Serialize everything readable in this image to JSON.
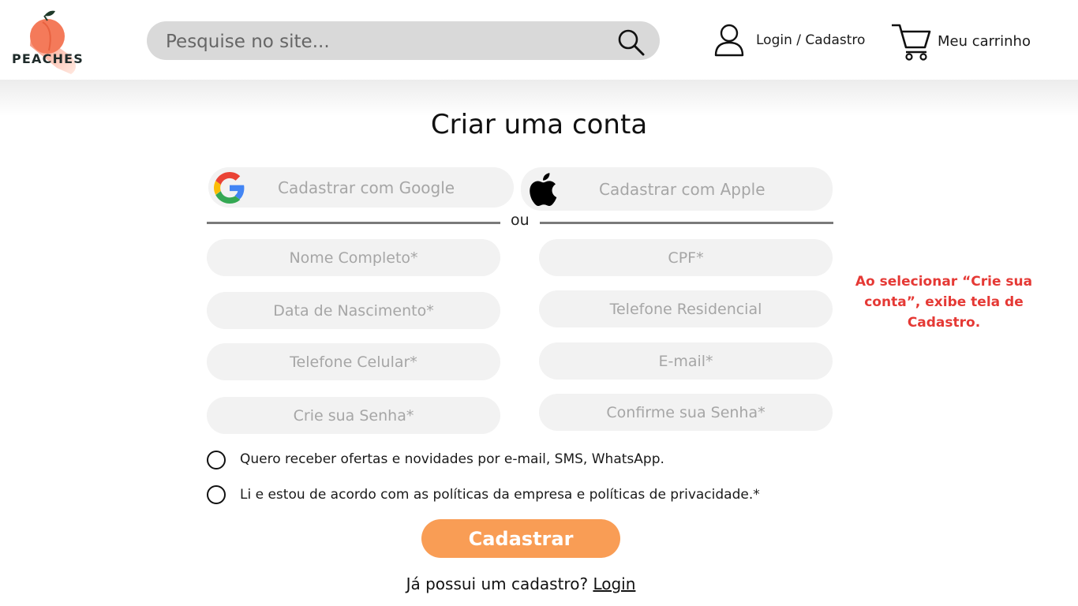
{
  "header": {
    "logo_text": "PEACHES",
    "search_placeholder": "Pesquise no site...",
    "account_label": "Login / Cadastro",
    "cart_label": "Meu carrinho"
  },
  "form": {
    "title": "Criar uma conta",
    "google_label": "Cadastrar com Google",
    "apple_label": "Cadastrar com Apple",
    "separator": "ou",
    "fields": {
      "nome": "Nome Completo*",
      "cpf": "CPF*",
      "nascimento": "Data de Nascimento*",
      "telefone_residencial": "Telefone Residencial",
      "celular": "Telefone Celular*",
      "email": "E-mail*",
      "senha": "Crie sua Senha*",
      "confirmar_senha": "Confirme sua Senha*"
    },
    "checkbox_offers": "Quero receber ofertas e novidades por e-mail, SMS, WhatsApp.",
    "checkbox_terms": "Li e estou de acordo com as  políticas da empresa e políticas de privacidade.*",
    "submit_label": "Cadastrar",
    "login_prompt": "Já possui um cadastro?",
    "login_link": "Login"
  },
  "annotation": {
    "text": "Ao selecionar “Crie sua conta”, exibe tela de Cadastro."
  },
  "colors": {
    "accent": "#f99d55",
    "note": "#e53935",
    "field_bg": "#f2f2f2",
    "search_bg": "#d9d9d9"
  }
}
